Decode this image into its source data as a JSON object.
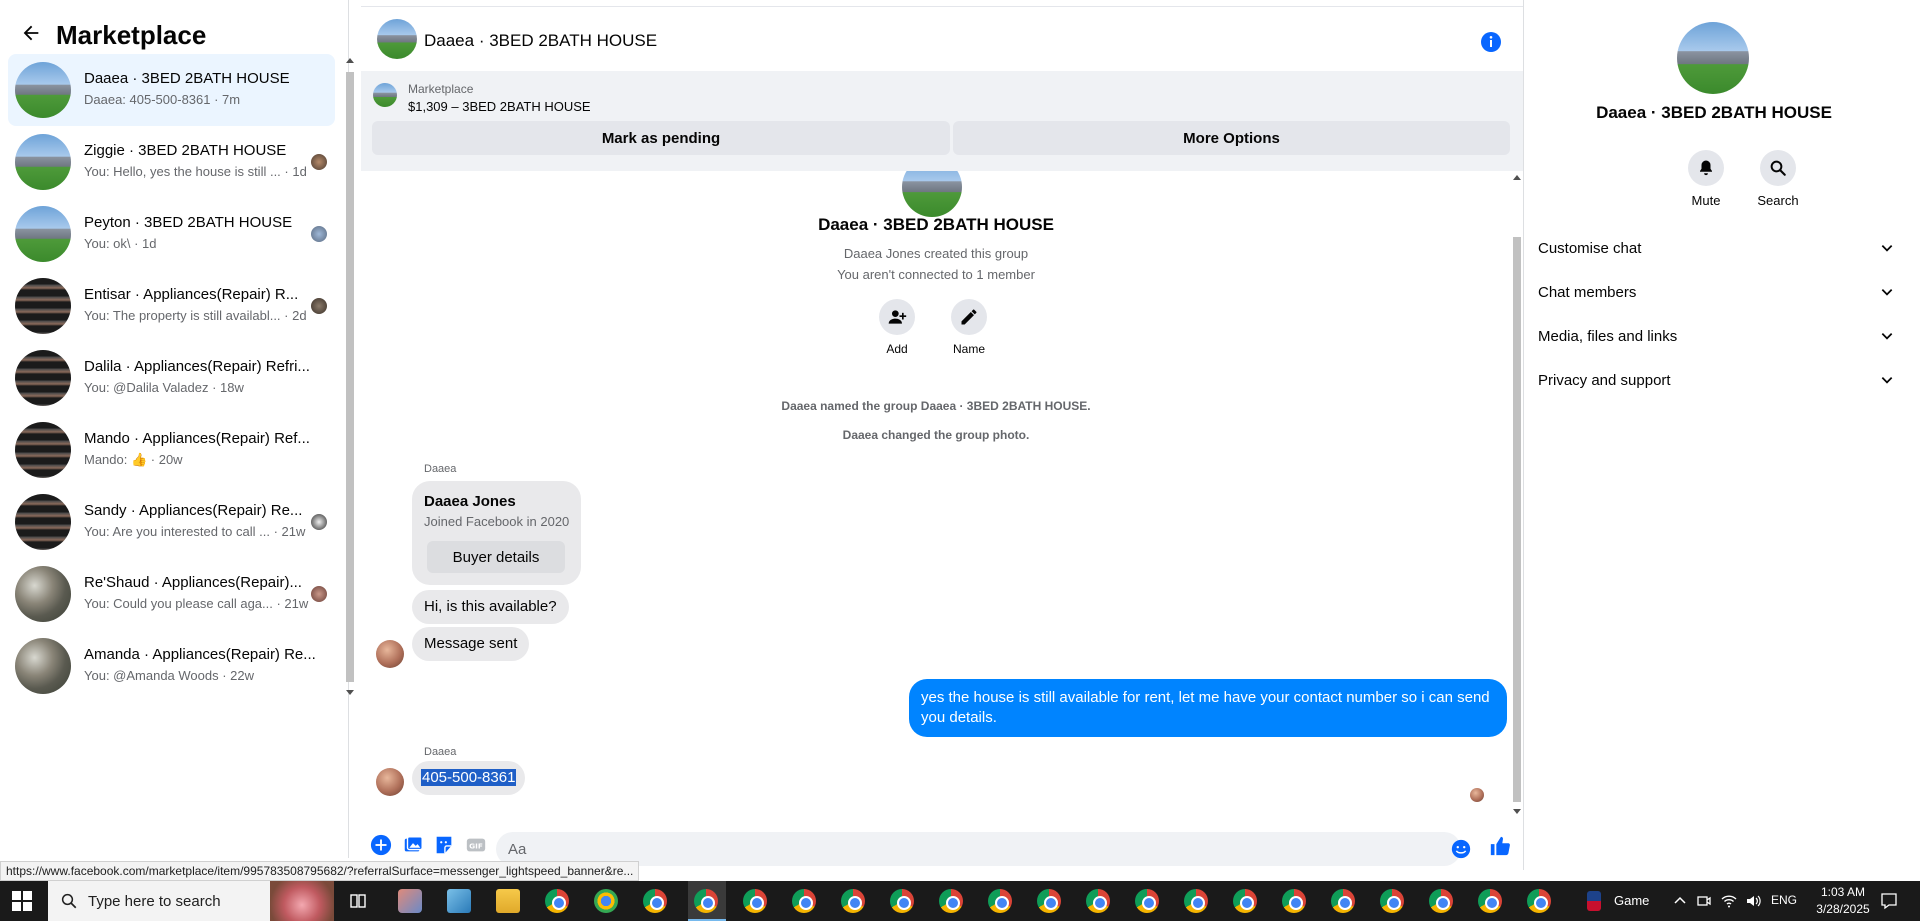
{
  "sidebar": {
    "title": "Marketplace",
    "conversations": [
      {
        "name": "Daaea · 3BED 2BATH HOUSE",
        "preview": "Daaea: 405-500-8361 · 7m",
        "thumb": "house",
        "active": true
      },
      {
        "name": "Ziggie · 3BED 2BATH HOUSE",
        "preview": "You: Hello, yes the house is still ...  · 1d",
        "thumb": "house"
      },
      {
        "name": "Peyton · 3BED 2BATH HOUSE",
        "preview": "You: ok\\ · 1d",
        "thumb": "house"
      },
      {
        "name": "Entisar · Appliances(Repair) R...",
        "preview": "You: The property is still availabl... · 2d",
        "thumb": "appliance"
      },
      {
        "name": "Dalila · Appliances(Repair) Refri...",
        "preview": "You: @Dalila Valadez · 18w",
        "thumb": "appliance"
      },
      {
        "name": "Mando · Appliances(Repair) Ref...",
        "preview": "Mando: 👍 · 20w",
        "thumb": "appliance"
      },
      {
        "name": "Sandy · Appliances(Repair) Re...",
        "preview": "You: Are you interested to call ... · 21w",
        "thumb": "appliance"
      },
      {
        "name": "Re'Shaud · Appliances(Repair)...",
        "preview": "You: Could you please call aga... · 21w",
        "thumb": "patio"
      },
      {
        "name": "Amanda · Appliances(Repair) Re...",
        "preview": "You: @Amanda Woods · 22w",
        "thumb": "patio"
      }
    ]
  },
  "chat": {
    "title": "Daaea · 3BED 2BATH HOUSE",
    "listing": {
      "label": "Marketplace",
      "price": "$1,309 – 3BED 2BATH HOUSE"
    },
    "buttons": {
      "pending": "Mark as pending",
      "more": "More Options"
    },
    "group": {
      "name": "Daaea · 3BED 2BATH HOUSE",
      "created_by": "Daaea Jones created this group",
      "connection": "You aren't connected to 1 member",
      "actions": {
        "add": "Add",
        "name": "Name"
      }
    },
    "system": {
      "named": "Daaea named the group Daaea · 3BED 2BATH HOUSE.",
      "photo": "Daaea changed the group photo."
    },
    "sender": "Daaea",
    "buyer": {
      "name": "Daaea Jones",
      "joined": "Joined Facebook in 2020",
      "button": "Buyer details"
    },
    "msg_available": "Hi, is this available?",
    "msg_sent": "Message sent",
    "my_reply": "yes the house is still available for rent, let me have your contact number so i can send you details.",
    "sender2": "Daaea",
    "phone": "405-500-8361",
    "composer_placeholder": "Aa"
  },
  "right_panel": {
    "name": "Daaea · 3BED 2BATH HOUSE",
    "actions": {
      "mute": "Mute",
      "search": "Search"
    },
    "sections": [
      "Customise chat",
      "Chat members",
      "Media, files and links",
      "Privacy and support"
    ]
  },
  "status_url": "https://www.facebook.com/marketplace/item/995783508795682/?referralSurface=messenger_lightspeed_banner&re...",
  "taskbar": {
    "search_placeholder": "Type here to search",
    "game_label": "Game",
    "lang": "ENG",
    "time": "1:03 AM",
    "date": "3/28/2025"
  },
  "colors": {
    "accent": "#0084ff",
    "info": "#0866ff",
    "bubble_gray": "#e9e9eb"
  }
}
